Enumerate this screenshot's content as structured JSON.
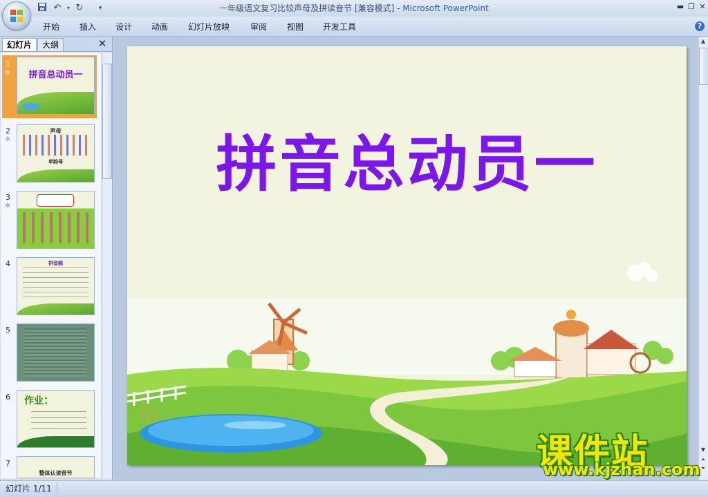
{
  "window": {
    "doc_title": "一年级语文复习比较声母及拼读音节 [兼容模式]",
    "separator": " - ",
    "app_name": "Microsoft PowerPoint"
  },
  "ribbon": {
    "tabs": [
      "开始",
      "插入",
      "设计",
      "动画",
      "幻灯片放映",
      "审阅",
      "视图",
      "开发工具"
    ]
  },
  "panel": {
    "tab_slides": "幻灯片",
    "tab_outline": "大纲",
    "slides": [
      {
        "num": "1",
        "title": "拼音总动员一"
      },
      {
        "num": "2",
        "title": "声母",
        "sub": "单韵母"
      },
      {
        "num": "3",
        "title": ""
      },
      {
        "num": "4",
        "title": "拼音题"
      },
      {
        "num": "5",
        "title": ""
      },
      {
        "num": "6",
        "title": "作业："
      },
      {
        "num": "7",
        "title": "整体认读音节"
      }
    ]
  },
  "slide": {
    "title": "拼音总动员一"
  },
  "status": {
    "text": "幻灯片 1/11"
  },
  "watermark": {
    "logo": "课件站",
    "url": "www.kjzhan.com"
  }
}
